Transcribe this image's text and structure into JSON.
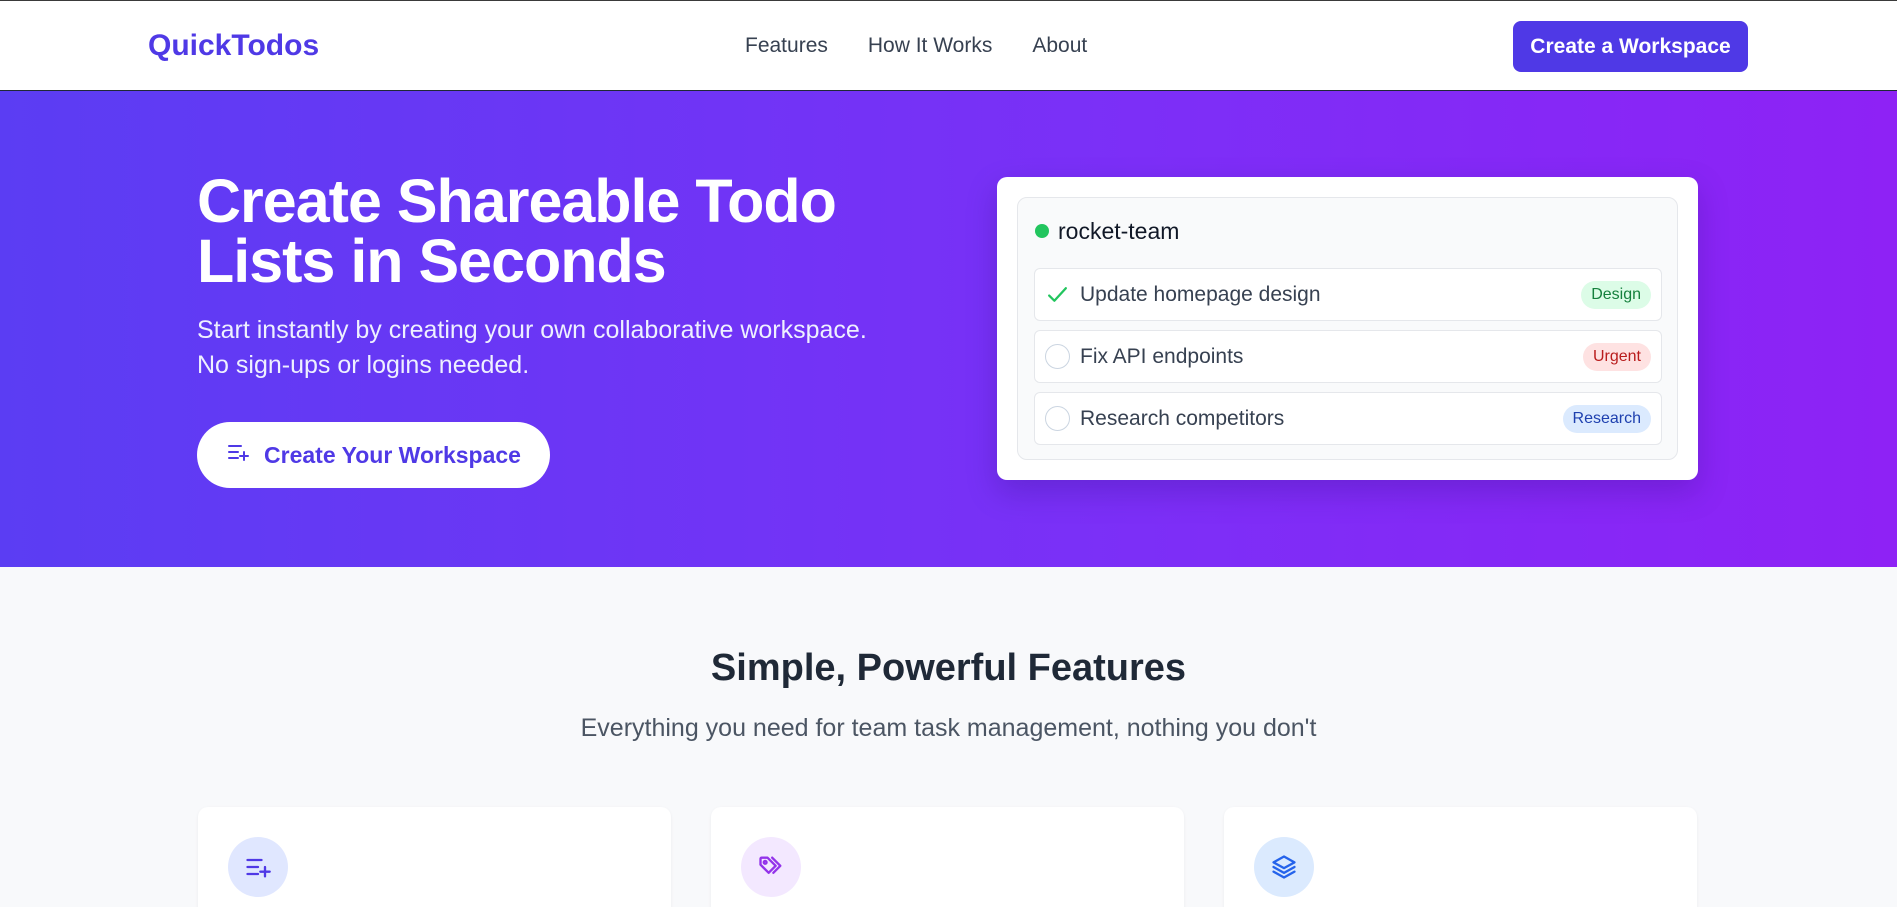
{
  "header": {
    "brand": "QuickTodos",
    "nav": [
      "Features",
      "How It Works",
      "About"
    ],
    "cta": "Create a Workspace"
  },
  "hero": {
    "title": "Create Shareable Todo Lists in Seconds",
    "subtitle_line1": "Start instantly by creating your own collaborative workspace.",
    "subtitle_line2": "No sign-ups or logins needed.",
    "button": "Create Your Workspace",
    "button_icon": "list-plus-icon"
  },
  "preview": {
    "workspace": "rocket-team",
    "status_color": "#22c55e",
    "tasks": [
      {
        "label": "Update homepage design",
        "tag": "Design",
        "done": true,
        "tag_bg": "#dcfce7",
        "tag_fg": "#15803d"
      },
      {
        "label": "Fix API endpoints",
        "tag": "Urgent",
        "done": false,
        "tag_bg": "#fee2e2",
        "tag_fg": "#b91c1c"
      },
      {
        "label": "Research competitors",
        "tag": "Research",
        "done": false,
        "tag_bg": "#dbeafe",
        "tag_fg": "#1e40af"
      }
    ]
  },
  "features": {
    "title": "Simple, Powerful Features",
    "subtitle": "Everything you need for team task management, nothing you don't",
    "cards": [
      {
        "icon": "list-plus-icon",
        "icon_bg": "#e0e7ff",
        "icon_color": "#4f39e6"
      },
      {
        "icon": "tags-icon",
        "icon_bg": "#f3e8ff",
        "icon_color": "#9333ea"
      },
      {
        "icon": "layers-icon",
        "icon_bg": "#dbeafe",
        "icon_color": "#2563eb"
      }
    ]
  },
  "colors": {
    "accent": "#4f39e6",
    "hero_start": "#5b3df3",
    "hero_end": "#8e22f5"
  }
}
